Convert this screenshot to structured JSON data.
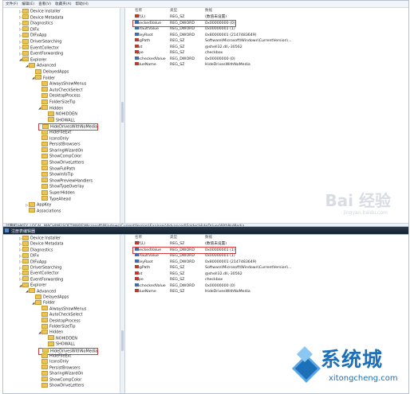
{
  "panel1": {
    "menu": [
      "文件(F)",
      "编辑(E)",
      "查看(V)",
      "收藏夹(A)",
      "帮助(H)"
    ],
    "tree": [
      {
        "label": "Device Installer",
        "level": 5,
        "exp": "▷"
      },
      {
        "label": "Device Metadata",
        "level": 5,
        "exp": "▷"
      },
      {
        "label": "Diagnostics",
        "level": 5,
        "exp": "▷"
      },
      {
        "label": "DIFx",
        "level": 5,
        "exp": "▷"
      },
      {
        "label": "DIFxApp",
        "level": 5,
        "exp": "▷"
      },
      {
        "label": "DriverSearching",
        "level": 5,
        "exp": "▷"
      },
      {
        "label": "EventCollector",
        "level": 5,
        "exp": "▷"
      },
      {
        "label": "EventForwarding",
        "level": 5,
        "exp": "▷"
      },
      {
        "label": "Explorer",
        "level": 5,
        "exp": "◢"
      },
      {
        "label": "Advanced",
        "level": 6,
        "exp": "◢"
      },
      {
        "label": "DelayedApps",
        "level": 7,
        "exp": ""
      },
      {
        "label": "Folder",
        "level": 7,
        "exp": "◢"
      },
      {
        "label": "AlwaysShowMenus",
        "level": 8,
        "exp": ""
      },
      {
        "label": "AutoCheckSelect",
        "level": 8,
        "exp": ""
      },
      {
        "label": "DesktopProcess",
        "level": 8,
        "exp": ""
      },
      {
        "label": "FolderSizeTip",
        "level": 8,
        "exp": ""
      },
      {
        "label": "Hidden",
        "level": 8,
        "exp": "◢"
      },
      {
        "label": "NOHIDDEN",
        "level": 9,
        "exp": ""
      },
      {
        "label": "SHOWALL",
        "level": 9,
        "exp": ""
      },
      {
        "label": "HideDrivesWithNoMedia",
        "level": 8,
        "exp": "",
        "selected": true
      },
      {
        "label": "HideFileExt",
        "level": 8,
        "exp": ""
      },
      {
        "label": "IconsOnly",
        "level": 8,
        "exp": ""
      },
      {
        "label": "PersistBrowsers",
        "level": 8,
        "exp": ""
      },
      {
        "label": "SharingWizardOn",
        "level": 8,
        "exp": ""
      },
      {
        "label": "ShowCompColor",
        "level": 8,
        "exp": ""
      },
      {
        "label": "ShowDriveLetters",
        "level": 8,
        "exp": ""
      },
      {
        "label": "ShowFullPath",
        "level": 8,
        "exp": ""
      },
      {
        "label": "ShowInfoTip",
        "level": 8,
        "exp": ""
      },
      {
        "label": "ShowPreviewHandlers",
        "level": 8,
        "exp": ""
      },
      {
        "label": "ShowTypeOverlay",
        "level": 8,
        "exp": ""
      },
      {
        "label": "SuperHidden",
        "level": 8,
        "exp": ""
      },
      {
        "label": "TypeAhead",
        "level": 8,
        "exp": ""
      },
      {
        "label": "AppKey",
        "level": 6,
        "exp": "▷"
      },
      {
        "label": "Associations",
        "level": 6,
        "exp": ""
      }
    ],
    "headers": {
      "name": "名称",
      "type": "类型",
      "data": "数据"
    },
    "values": [
      {
        "icon": "ab",
        "name": "(默认)",
        "type": "REG_SZ",
        "data": "(数值未设置)"
      },
      {
        "icon": "bin",
        "name": "CheckedValue",
        "type": "REG_DWORD",
        "data": "0x00000000 (0)",
        "highlight": true
      },
      {
        "icon": "bin",
        "name": "DefaultValue",
        "type": "REG_DWORD",
        "data": "0x00000001 (1)"
      },
      {
        "icon": "bin",
        "name": "HKeyRoot",
        "type": "REG_DWORD",
        "data": "0x80000001 (2147483649)"
      },
      {
        "icon": "ab",
        "name": "RegPath",
        "type": "REG_SZ",
        "data": "Software\\Microsoft\\Windows\\CurrentVersion\\..."
      },
      {
        "icon": "ab",
        "name": "Text",
        "type": "REG_SZ",
        "data": "@shell32.dll,-30562"
      },
      {
        "icon": "ab",
        "name": "Type",
        "type": "REG_SZ",
        "data": "checkbox"
      },
      {
        "icon": "bin",
        "name": "UncheckedValue",
        "type": "REG_DWORD",
        "data": "0x00000000 (0)"
      },
      {
        "icon": "ab",
        "name": "ValueName",
        "type": "REG_SZ",
        "data": "HideDrivesWithNoMedia"
      }
    ],
    "status": "计算机\\HKEY_LOCAL_MACHINE\\SOFTWARE\\Microsoft\\Windows\\CurrentVersion\\Explorer\\Advanced\\Folder\\HideDrivesWithNoMedia",
    "watermark": "Bai 经验",
    "watermark_url": "jingyan.baidu.com"
  },
  "panel2": {
    "title": "注册表编辑器",
    "tree": [
      {
        "label": "Device Installer",
        "level": 5,
        "exp": "▷"
      },
      {
        "label": "Device Metadata",
        "level": 5,
        "exp": "▷"
      },
      {
        "label": "Diagnostics",
        "level": 5,
        "exp": "▷"
      },
      {
        "label": "DIFx",
        "level": 5,
        "exp": "▷"
      },
      {
        "label": "DIFxApp",
        "level": 5,
        "exp": "▷"
      },
      {
        "label": "DriverSearching",
        "level": 5,
        "exp": "▷"
      },
      {
        "label": "EventCollector",
        "level": 5,
        "exp": "▷"
      },
      {
        "label": "EventForwarding",
        "level": 5,
        "exp": "▷"
      },
      {
        "label": "Explorer",
        "level": 5,
        "exp": "◢"
      },
      {
        "label": "Advanced",
        "level": 6,
        "exp": "◢"
      },
      {
        "label": "DelayedApps",
        "level": 7,
        "exp": ""
      },
      {
        "label": "Folder",
        "level": 7,
        "exp": "◢"
      },
      {
        "label": "AlwaysShowMenus",
        "level": 8,
        "exp": ""
      },
      {
        "label": "AutoCheckSelect",
        "level": 8,
        "exp": ""
      },
      {
        "label": "DesktopProcess",
        "level": 8,
        "exp": ""
      },
      {
        "label": "FolderSizeTip",
        "level": 8,
        "exp": ""
      },
      {
        "label": "Hidden",
        "level": 8,
        "exp": "◢"
      },
      {
        "label": "NOHIDDEN",
        "level": 9,
        "exp": ""
      },
      {
        "label": "SHOWALL",
        "level": 9,
        "exp": ""
      },
      {
        "label": "HideDrivesWithNoMedia",
        "level": 8,
        "exp": "",
        "selected": true
      },
      {
        "label": "HideFileExt",
        "level": 8,
        "exp": ""
      },
      {
        "label": "IconsOnly",
        "level": 8,
        "exp": ""
      },
      {
        "label": "PersistBrowsers",
        "level": 8,
        "exp": ""
      },
      {
        "label": "SharingWizardOn",
        "level": 8,
        "exp": ""
      },
      {
        "label": "ShowCompColor",
        "level": 8,
        "exp": ""
      },
      {
        "label": "ShowDriveLetters",
        "level": 8,
        "exp": ""
      }
    ],
    "headers": {
      "name": "名称",
      "type": "类型",
      "data": "数据"
    },
    "values": [
      {
        "icon": "ab",
        "name": "(默认)",
        "type": "REG_SZ",
        "data": "(数值未设置)"
      },
      {
        "icon": "bin",
        "name": "CheckedValue",
        "type": "REG_DWORD",
        "data": "0x00000001 (1)",
        "highlight": true
      },
      {
        "icon": "bin",
        "name": "DefaultValue",
        "type": "REG_DWORD",
        "data": "0x00000001 (1)"
      },
      {
        "icon": "bin",
        "name": "HKeyRoot",
        "type": "REG_DWORD",
        "data": "0x80000001 (2147483649)"
      },
      {
        "icon": "ab",
        "name": "RegPath",
        "type": "REG_SZ",
        "data": "Software\\Microsoft\\Windows\\CurrentVersion\\..."
      },
      {
        "icon": "ab",
        "name": "Text",
        "type": "REG_SZ",
        "data": "@shell32.dll,-30562"
      },
      {
        "icon": "ab",
        "name": "Type",
        "type": "REG_SZ",
        "data": "checkbox"
      },
      {
        "icon": "bin",
        "name": "UncheckedValue",
        "type": "REG_DWORD",
        "data": "0x00000000 (0)"
      },
      {
        "icon": "ab",
        "name": "ValueName",
        "type": "REG_SZ",
        "data": "HideDrivesWithNoMedia"
      }
    ]
  },
  "logo": {
    "text": "系统城",
    "url": "xitongcheng.com",
    "colors": {
      "blue": "#1d6fb8",
      "light": "#5aa7e6"
    }
  }
}
